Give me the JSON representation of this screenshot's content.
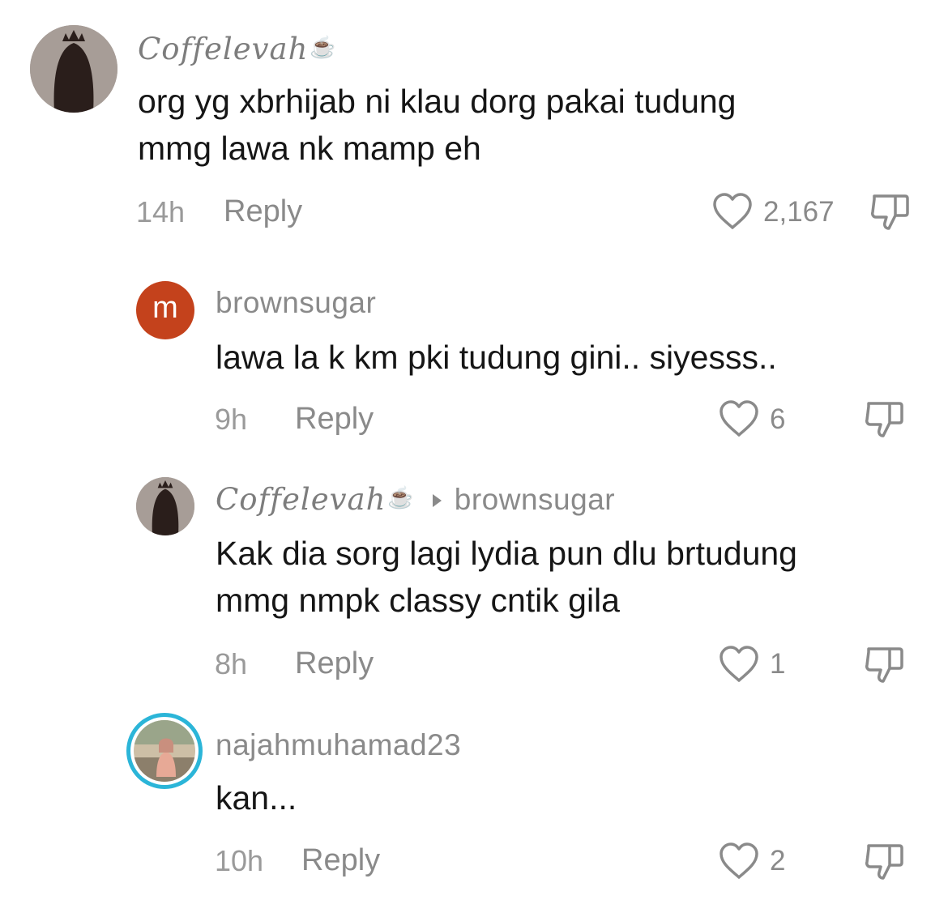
{
  "comments": [
    {
      "username": "Coffelevah",
      "text_lines": [
        "org yg xbrhijab ni klau dorg pakai tudung",
        "mmg lawa nk mamp eh"
      ],
      "time": "14h",
      "reply_label": "Reply",
      "likes": "2,167"
    },
    {
      "avatar_letter": "m",
      "username": "brownsugar",
      "text_lines": [
        "lawa la k km pki tudung gini.. siyesss.."
      ],
      "time": "9h",
      "reply_label": "Reply",
      "likes": "6"
    },
    {
      "username": "Coffelevah",
      "reply_to": "brownsugar",
      "text_lines": [
        "Kak dia sorg lagi lydia pun dlu brtudung",
        "mmg nmpk classy cntik gila"
      ],
      "time": "8h",
      "reply_label": "Reply",
      "likes": "1"
    },
    {
      "username": "najahmuhamad23",
      "text_lines": [
        "kan..."
      ],
      "time": "10h",
      "reply_label": "Reply",
      "likes": "2"
    }
  ],
  "icons": {
    "like": "heart-outline-icon",
    "dislike": "thumbs-down-outline-icon",
    "username_suffix": "coffee-cup-icon",
    "reply_to": "triangle-right-icon"
  },
  "colors": {
    "avatar_m_bg": "#c4421c",
    "story_ring": "#2bb5d8",
    "text": "#161616",
    "muted": "#8a8a8a"
  }
}
